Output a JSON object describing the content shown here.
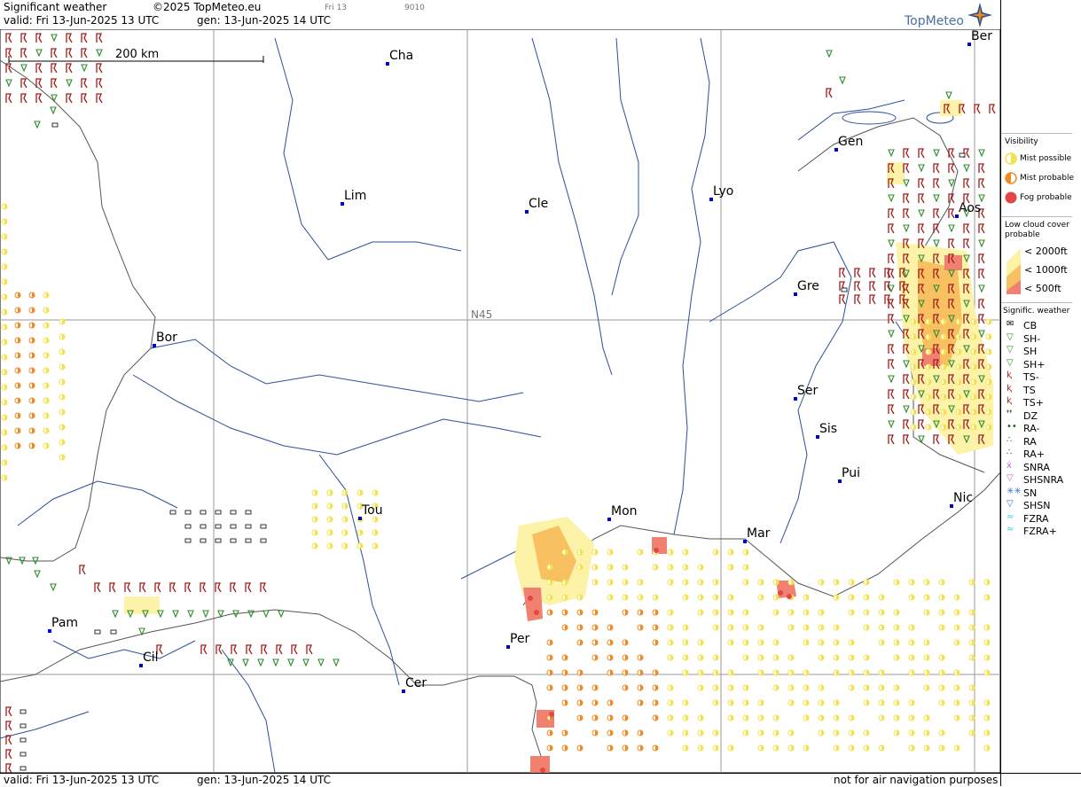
{
  "header": {
    "title": "Significant weather",
    "copyright": "©2025 TopMeteo.eu",
    "valid": "valid:  Fri  13-Jun-2025  13 UTC",
    "gen": "gen: 13-Jun-2025 14 UTC",
    "small_day": "Fri 13",
    "small_code": "9010",
    "logo_text": "TopMeteo"
  },
  "footer": {
    "valid": "valid:  Fri  13-Jun-2025  13 UTC",
    "gen": "gen: 13-Jun-2025 14 UTC",
    "disclaimer": "not for air navigation purposes"
  },
  "map": {
    "scale_label": "200 km",
    "lat_label": "N45",
    "cities": [
      {
        "name": "Cha"
      },
      {
        "name": "Lim"
      },
      {
        "name": "Cle"
      },
      {
        "name": "Lyo"
      },
      {
        "name": "Gen"
      },
      {
        "name": "Ber"
      },
      {
        "name": "Aos"
      },
      {
        "name": "Gre"
      },
      {
        "name": "Bor"
      },
      {
        "name": "Ser"
      },
      {
        "name": "Sis"
      },
      {
        "name": "Pui"
      },
      {
        "name": "Tou"
      },
      {
        "name": "Mon"
      },
      {
        "name": "Mar"
      },
      {
        "name": "Nic"
      },
      {
        "name": "Pam"
      },
      {
        "name": "Cil"
      },
      {
        "name": "Per"
      },
      {
        "name": "Cer"
      }
    ]
  },
  "legend": {
    "visibility_title": "Visibility",
    "visibility_items": [
      "Mist possible",
      "Mist probable",
      "Fog probable"
    ],
    "lowcloud_title_1": "Low cloud cover",
    "lowcloud_title_2": "probable",
    "lowcloud_items": [
      "< 2000ft",
      "< 1000ft",
      "<   500ft"
    ],
    "sigwx_title": "Signific. weather",
    "sigwx_items": [
      "CB",
      "SH-",
      "SH",
      "SH+",
      "TS-",
      "TS",
      "TS+",
      "DZ",
      "RA-",
      "RA",
      "RA+",
      "SNRA",
      "SHSNRA",
      "SN",
      "SHSN",
      "FZRA",
      "FZRA+"
    ],
    "colors": {
      "mist_possible": "#f4e24a",
      "mist_probable": "#f08a24",
      "fog_probable": "#e24646",
      "cloud_2000": "#fdf3a8",
      "cloud_1000": "#f8c060",
      "cloud_500": "#f08070",
      "rain": "#2e8b2e",
      "thunder": "#a01c1c",
      "snow": "#3a6fd8"
    }
  }
}
